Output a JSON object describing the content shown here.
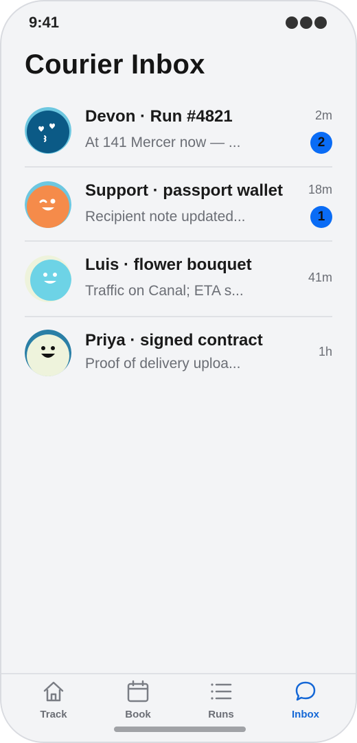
{
  "status_bar": {
    "time": "9:41",
    "icon": "ellipsis-icon"
  },
  "header": {
    "title": "Courier Inbox"
  },
  "threads": [
    {
      "name": "Devon · Run #4821",
      "preview": "At 141 Mercer now — ...",
      "time": "2m",
      "unread": "2",
      "avatar": "heart-eyes-avatar",
      "avatar_color": "#0b5a86"
    },
    {
      "name": "Support · passport wallet",
      "preview": "Recipient note updated...",
      "time": "18m",
      "unread": "1",
      "avatar": "wink-avatar",
      "avatar_color": "#f58b4a"
    },
    {
      "name": "Luis · flower bouquet",
      "preview": "Traffic on Canal; ETA s...",
      "time": "41m",
      "unread": null,
      "avatar": "smile-avatar",
      "avatar_color": "#6dd3e6"
    },
    {
      "name": "Priya · signed contract",
      "preview": "Proof of delivery uploa...",
      "time": "1h",
      "unread": null,
      "avatar": "grin-avatar",
      "avatar_color": "#eef3dc"
    }
  ],
  "tab_bar": {
    "tabs": [
      {
        "label": "Track",
        "icon": "home-icon",
        "active": false
      },
      {
        "label": "Book",
        "icon": "calendar-icon",
        "active": false
      },
      {
        "label": "Runs",
        "icon": "list-icon",
        "active": false
      },
      {
        "label": "Inbox",
        "icon": "chat-bubble-icon",
        "active": true
      }
    ],
    "active_color": "#1467d6",
    "inactive_color": "#6b6e75"
  },
  "colors": {
    "background": "#f3f4f6",
    "badge": "#0a6cf5",
    "title": "#151515",
    "secondary_text": "#6b6e75"
  }
}
